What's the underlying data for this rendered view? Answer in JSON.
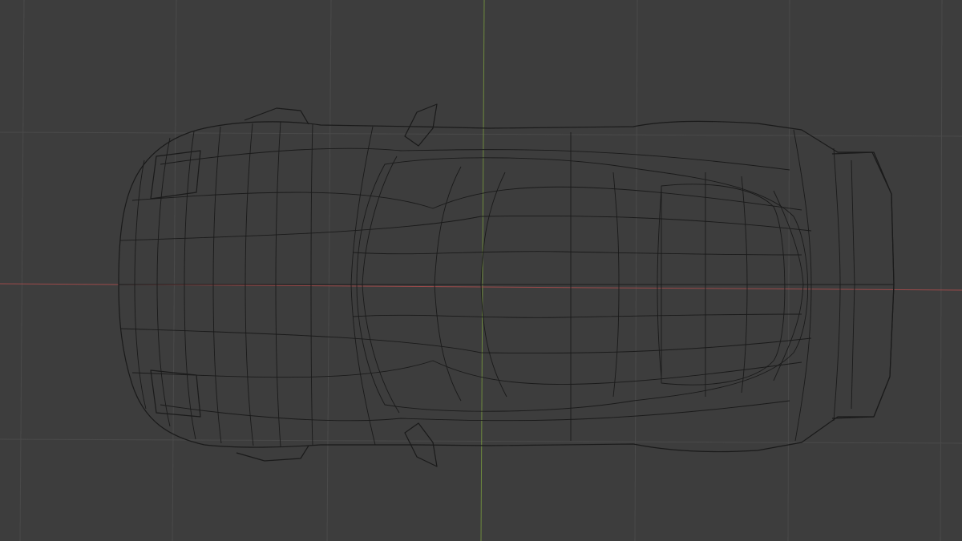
{
  "viewport": {
    "mode": "wireframe",
    "view": "top",
    "object": "car-mesh",
    "colors": {
      "background": "#3d3d3d",
      "grid": "#4a4a4a",
      "x_axis": "#9b4a4a",
      "y_axis": "#6e8a3e",
      "wire": "#1a1a1a"
    }
  }
}
